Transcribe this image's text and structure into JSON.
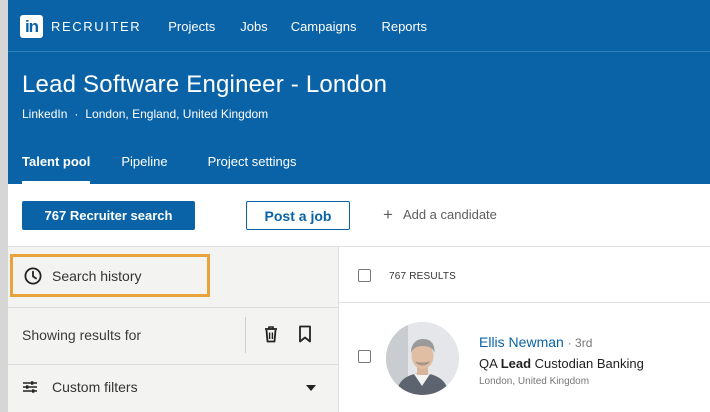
{
  "nav": {
    "logo_text": "in",
    "brand": "RECRUITER",
    "links": [
      "Projects",
      "Jobs",
      "Campaigns",
      "Reports"
    ]
  },
  "project": {
    "title": "Lead Software Engineer - London",
    "company": "LinkedIn",
    "separator": "·",
    "location": "London, England, United Kingdom"
  },
  "tabs": [
    {
      "label": "Talent pool",
      "active": true
    },
    {
      "label": "Pipeline",
      "active": false
    },
    {
      "label": "Project settings",
      "active": false
    }
  ],
  "actions": {
    "recruiter_search_label": "767 Recruiter search",
    "post_job_label": "Post a job",
    "add_candidate_icon": "+",
    "add_candidate_label": "Add a candidate"
  },
  "left_panel": {
    "search_history_label": "Search history",
    "showing_results_label": "Showing results for",
    "custom_filters_label": "Custom filters"
  },
  "results": {
    "count_label": "767 RESULTS"
  },
  "candidate": {
    "name": "Ellis Newman",
    "degree": "· 3rd",
    "title_prefix": "QA",
    "title_highlight": "Lead",
    "title_suffix": "Custodian Banking",
    "location": "London, United Kingdom"
  },
  "colors": {
    "brand_blue": "#0a63a6",
    "highlight_orange": "#e8a33d"
  },
  "icons": {
    "search_history": "clock-icon",
    "clear": "trash-icon",
    "save": "bookmark-icon",
    "filters": "sliders-icon",
    "dropdown": "caret-down-icon",
    "add": "plus-icon"
  }
}
